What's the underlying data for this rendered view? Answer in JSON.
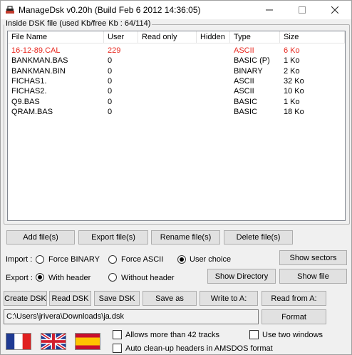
{
  "window": {
    "title": "ManageDsk v0.20h (Build Feb  6 2012 14:36:05)",
    "controls": {
      "minimize": "—",
      "maximize": "☐",
      "close": "✕"
    }
  },
  "group_label": "Inside DSK file (used Kb/free Kb : 64/114)",
  "columns": [
    "File Name",
    "User",
    "Read only",
    "Hidden",
    "Type",
    "Size"
  ],
  "files": [
    {
      "name": "16-12-89.CAL",
      "user": "229",
      "read_only": "",
      "hidden": "",
      "type": "ASCII",
      "size": "6 Ko",
      "highlight": true
    },
    {
      "name": "BANKMAN.BAS",
      "user": "0",
      "read_only": "",
      "hidden": "",
      "type": "BASIC (P)",
      "size": "1 Ko"
    },
    {
      "name": "BANKMAN.BIN",
      "user": "0",
      "read_only": "",
      "hidden": "",
      "type": "BINARY",
      "size": "2 Ko"
    },
    {
      "name": "FICHAS1.",
      "user": "0",
      "read_only": "",
      "hidden": "",
      "type": "ASCII",
      "size": "32 Ko"
    },
    {
      "name": "FICHAS2.",
      "user": "0",
      "read_only": "",
      "hidden": "",
      "type": "ASCII",
      "size": "10 Ko"
    },
    {
      "name": "Q9.BAS",
      "user": "0",
      "read_only": "",
      "hidden": "",
      "type": "BASIC",
      "size": "1 Ko"
    },
    {
      "name": "QRAM.BAS",
      "user": "0",
      "read_only": "",
      "hidden": "",
      "type": "BASIC",
      "size": "18 Ko"
    }
  ],
  "highlight_color": "#e8281f",
  "file_buttons": {
    "add": "Add file(s)",
    "export": "Export file(s)",
    "rename": "Rename file(s)",
    "delete": "Delete file(s)"
  },
  "import": {
    "label": "Import :",
    "options": [
      "Force BINARY",
      "Force ASCII",
      "User choice"
    ],
    "selected": "User choice"
  },
  "export": {
    "label": "Export :",
    "options": [
      "With header",
      "Without header"
    ],
    "selected": "With header"
  },
  "side_buttons": {
    "show_sectors": "Show sectors",
    "show_directory": "Show Directory",
    "show_file": "Show file"
  },
  "dsk_buttons": {
    "create": "Create DSK",
    "read": "Read DSK",
    "save": "Save DSK",
    "save_as": "Save as",
    "write_to": "Write to A:",
    "read_from": "Read from A:"
  },
  "path": "C:\\Users\\jrivera\\Downloads\\ja.dsk",
  "format_button": "Format",
  "languages": [
    "flag-france",
    "flag-uk",
    "flag-spain"
  ],
  "options": {
    "allow_42_tracks": "Allows more than 42 tracks",
    "auto_cleanup": "Auto clean-up headers in AMSDOS format",
    "two_windows": "Use two windows"
  }
}
